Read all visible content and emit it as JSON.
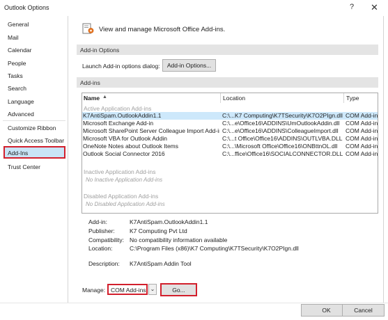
{
  "window": {
    "title": "Outlook Options",
    "help_glyph": "?",
    "close_glyph": "✕"
  },
  "sidebar": {
    "items": [
      {
        "label": "General"
      },
      {
        "label": "Mail"
      },
      {
        "label": "Calendar"
      },
      {
        "label": "People"
      },
      {
        "label": "Tasks"
      },
      {
        "label": "Search"
      },
      {
        "label": "Language"
      },
      {
        "label": "Advanced"
      },
      {
        "label": "Customize Ribbon"
      },
      {
        "label": "Quick Access Toolbar"
      },
      {
        "label": "Add-Ins",
        "selected": true
      },
      {
        "label": "Trust Center"
      }
    ]
  },
  "main": {
    "header": "View and manage Microsoft Office Add-ins.",
    "addin_options": {
      "section_title": "Add-in Options",
      "launch_label": "Launch Add-in options dialog:",
      "button_label": "Add-in Options..."
    },
    "addins": {
      "section_title": "Add-ins",
      "columns": {
        "name": "Name",
        "location": "Location",
        "type": "Type"
      },
      "groups": {
        "active": "Active Application Add-ins",
        "inactive": "Inactive Application Add-ins",
        "inactive_empty": "No Inactive Application Add-ins",
        "disabled": "Disabled Application Add-ins",
        "disabled_empty": "No Disabled Application Add-ins"
      },
      "rows": [
        {
          "name": "K7AntiSpam.OutlookAddin1.1",
          "location": "C:\\...K7 Computing\\K7TSecurity\\K7O2PIgn.dll",
          "type": "COM Add-in",
          "selected": true
        },
        {
          "name": "Microsoft Exchange Add-in",
          "location": "C:\\...e\\Office16\\ADDINS\\UmOutlookAddin.dll",
          "type": "COM Add-in"
        },
        {
          "name": "Microsoft SharePoint Server Colleague Import Add-in",
          "location": "C:\\...e\\Office16\\ADDINS\\ColleagueImport.dll",
          "type": "COM Add-in"
        },
        {
          "name": "Microsoft VBA for Outlook Addin",
          "location": "C:\\...t Office\\Office16\\ADDINS\\OUTLVBA.DLL",
          "type": "COM Add-in"
        },
        {
          "name": "OneNote Notes about Outlook Items",
          "location": "C:\\...\\Microsoft Office\\Office16\\ONBttnOL.dll",
          "type": "COM Add-in"
        },
        {
          "name": "Outlook Social Connector 2016",
          "location": "C:\\...ffice\\Office16\\SOCIALCONNECTOR.DLL",
          "type": "COM Add-in"
        }
      ]
    },
    "details": {
      "addin_label": "Add-in:",
      "addin_value": "K7AntiSpam.OutlookAddin1.1",
      "publisher_label": "Publisher:",
      "publisher_value": "K7 Computing Pvt Ltd",
      "compat_label": "Compatibility:",
      "compat_value": "No compatibility information available",
      "location_label": "Location:",
      "location_value": "C:\\Program Files (x86)\\K7 Computing\\K7TSecurity\\K7O2PIgn.dll",
      "description_label": "Description:",
      "description_value": "K7AntiSpam Addin Tool"
    },
    "manage": {
      "label": "Manage:",
      "selected_option": "COM Add-ins",
      "go_label": "Go..."
    }
  },
  "footer": {
    "ok_label": "OK",
    "cancel_label": "Cancel"
  },
  "colors": {
    "highlight_outline": "#d21f2c",
    "selected_bg": "#c9e4f6",
    "section_bg": "#e4e4e4"
  }
}
